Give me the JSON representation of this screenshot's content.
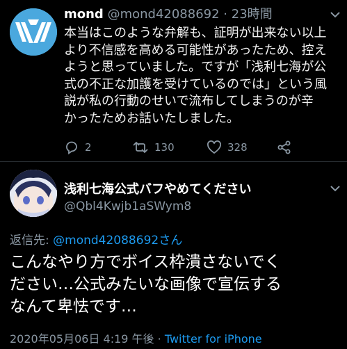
{
  "tweet1": {
    "name": "mond",
    "handle": "@mond42088692",
    "separator": "·",
    "time": "23時間",
    "lines": [
      "本当はこのような弁解も、証明が出来ない以上",
      "より不信感を高める可能性があったため、控え",
      "ようと思っていました。ですが「浅利七海が公",
      "式の不正な加護を受けているのでは」という風",
      "説が私の行動のせいで流布してしまうのが辛",
      "かったためお話いたしました。"
    ],
    "replies": "2",
    "retweets": "130",
    "likes": "328",
    "icons": [
      "reply-icon",
      "retweet-icon",
      "like-icon",
      "share-icon",
      "chevron-down-icon"
    ]
  },
  "tweet2": {
    "name": "浅利七海公式バフやめてください",
    "handle": "@Qbl4Kwjb1aSWym8",
    "reply_label": "返信先: ",
    "reply_to": "@mond42088692さん",
    "lines": [
      "こんなやり方でボイス枠潰さないでく",
      "ださい…公式みたいな画像で宣伝する",
      "なんて卑怯です…"
    ],
    "timestamp": "2020年05月06日 4:19 午後 · ",
    "source": "Twitter for iPhone"
  },
  "colors": {
    "background": "#000000",
    "muted": "#8a97a3",
    "link": "#1d9bf0",
    "avatar1": "#4aa8de"
  }
}
